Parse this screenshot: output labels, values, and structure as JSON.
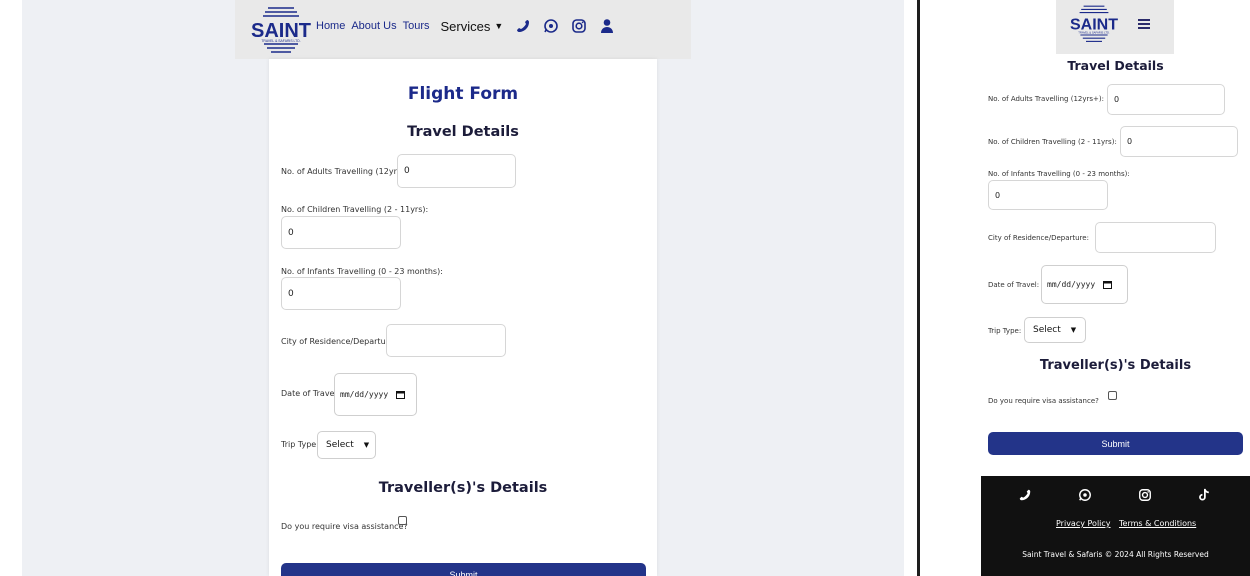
{
  "brand": {
    "name": "SAINT",
    "tagline": "TRAVEL & SAFARIS LTD.",
    "color": "#1b2a8a"
  },
  "nav": {
    "links": [
      "Home",
      "About Us",
      "Tours"
    ],
    "services": "Services",
    "icons": [
      "phone-icon",
      "whatsapp-icon",
      "instagram-icon",
      "user-icon"
    ]
  },
  "form": {
    "title": "Flight Form",
    "section_travel": "Travel Details",
    "adults_label": "No. of Adults Travelling (12yrs+):",
    "adults_value": "0",
    "children_label": "No. of Children Travelling (2 - 11yrs):",
    "children_value": "0",
    "infants_label": "No. of Infants Travelling (0 - 23 months):",
    "infants_value": "0",
    "city_label": "City of Residence/Departure:",
    "city_value": "",
    "date_label": "Date of Travel:",
    "date_placeholder": "mm/dd/yyyy",
    "trip_label": "Trip Type:",
    "trip_selected": "Select",
    "section_traveller": "Traveller(s)'s Details",
    "visa_label": "Do you require visa assistance?",
    "submit_label": "Submit"
  },
  "footer": {
    "privacy": "Privacy Policy",
    "terms": "Terms & Conditions",
    "copyright": "Saint Travel & Safaris © 2024 All Rights Reserved",
    "icons": [
      "phone-icon",
      "whatsapp-icon",
      "instagram-icon",
      "tiktok-icon"
    ]
  },
  "colors": {
    "primary": "#233489",
    "title": "#1c2a8a",
    "footer_bg": "#111111"
  }
}
